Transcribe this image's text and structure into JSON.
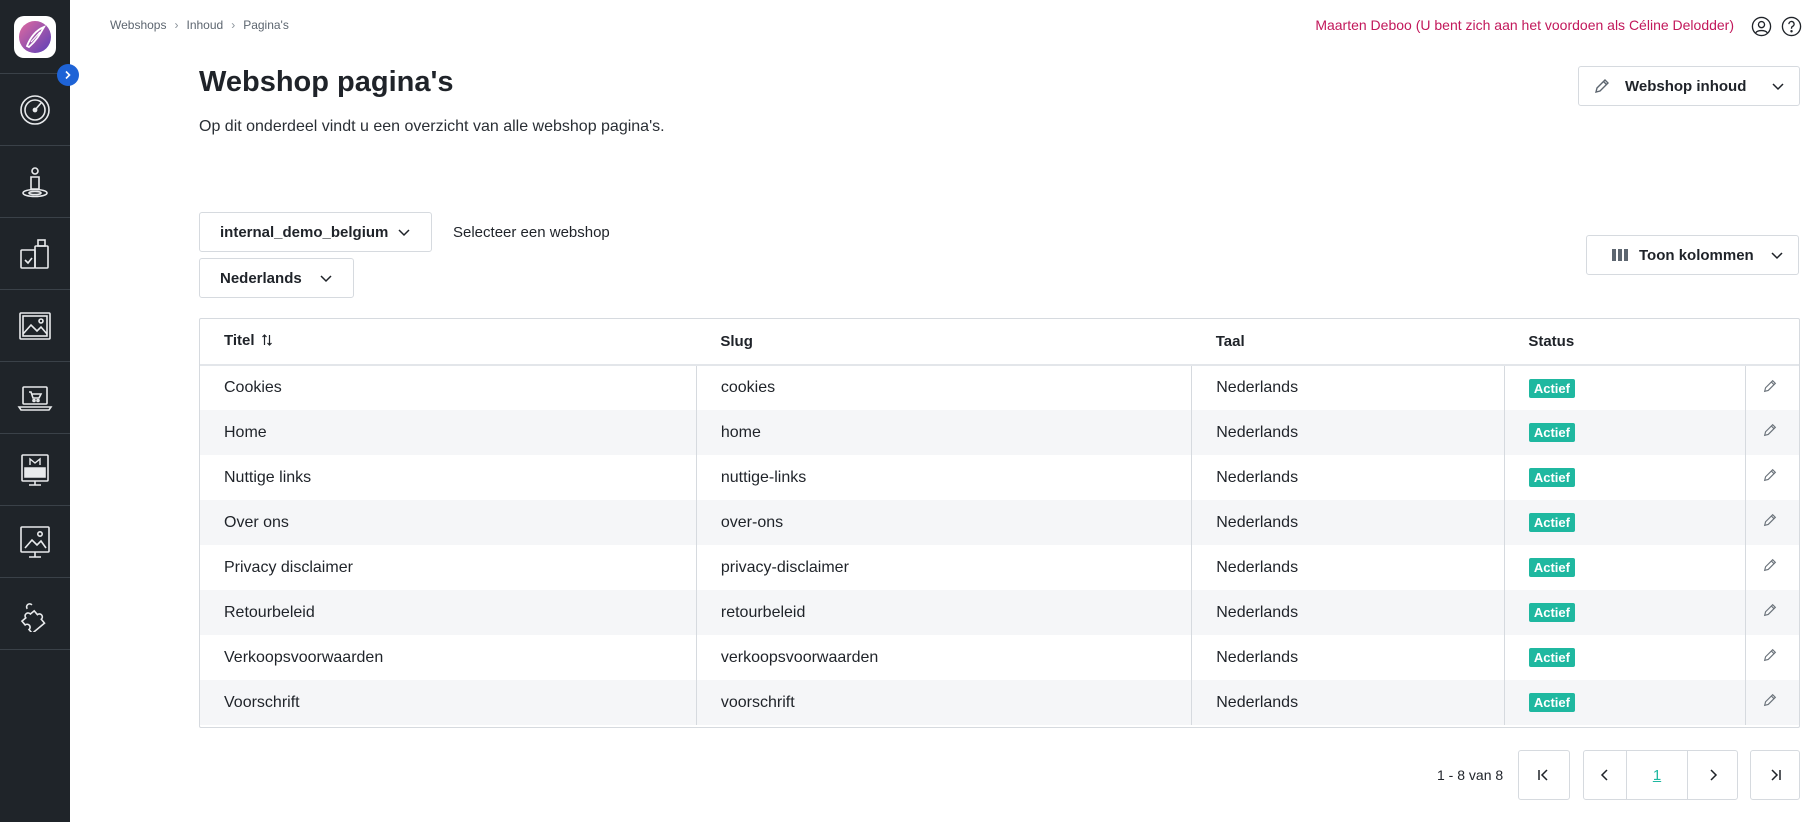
{
  "breadcrumb": {
    "items": [
      "Webshops",
      "Inhoud",
      "Pagina's"
    ]
  },
  "user": {
    "label": "Maarten Deboo (U bent zich aan het voordoen als Céline Delodder)"
  },
  "page": {
    "title": "Webshop pagina's",
    "description": "Op dit onderdeel vindt u een overzicht van alle webshop pagina's."
  },
  "actions": {
    "inhoud_label": "Webshop inhoud",
    "columns_label": "Toon kolommen"
  },
  "filters": {
    "webshop_value": "internal_demo_belgium",
    "webshop_hint": "Selecteer een webshop",
    "language_value": "Nederlands"
  },
  "table": {
    "headers": [
      "Titel",
      "Slug",
      "Taal",
      "Status"
    ],
    "rows": [
      {
        "title": "Cookies",
        "slug": "cookies",
        "lang": "Nederlands",
        "status": "Actief"
      },
      {
        "title": "Home",
        "slug": "home",
        "lang": "Nederlands",
        "status": "Actief"
      },
      {
        "title": "Nuttige links",
        "slug": "nuttige-links",
        "lang": "Nederlands",
        "status": "Actief"
      },
      {
        "title": "Over ons",
        "slug": "over-ons",
        "lang": "Nederlands",
        "status": "Actief"
      },
      {
        "title": "Privacy disclaimer",
        "slug": "privacy-disclaimer",
        "lang": "Nederlands",
        "status": "Actief"
      },
      {
        "title": "Retourbeleid",
        "slug": "retourbeleid",
        "lang": "Nederlands",
        "status": "Actief"
      },
      {
        "title": "Verkoopsvoorwaarden",
        "slug": "verkoopsvoorwaarden",
        "lang": "Nederlands",
        "status": "Actief"
      },
      {
        "title": "Voorschrift",
        "slug": "voorschrift",
        "lang": "Nederlands",
        "status": "Actief"
      }
    ]
  },
  "pagination": {
    "summary": "1 - 8 van 8",
    "current_page": "1"
  },
  "colors": {
    "sidebar": "#1f2429",
    "accent": "#1fb8a0",
    "user_text": "#c2185b",
    "toggle": "#1e63d6"
  },
  "sidebar": {
    "icons": [
      "dashboard-icon",
      "person-icon",
      "products-icon",
      "image-icon",
      "laptop-cart-icon",
      "monitor-m-icon",
      "presentation-icon",
      "puzzle-icon"
    ]
  }
}
